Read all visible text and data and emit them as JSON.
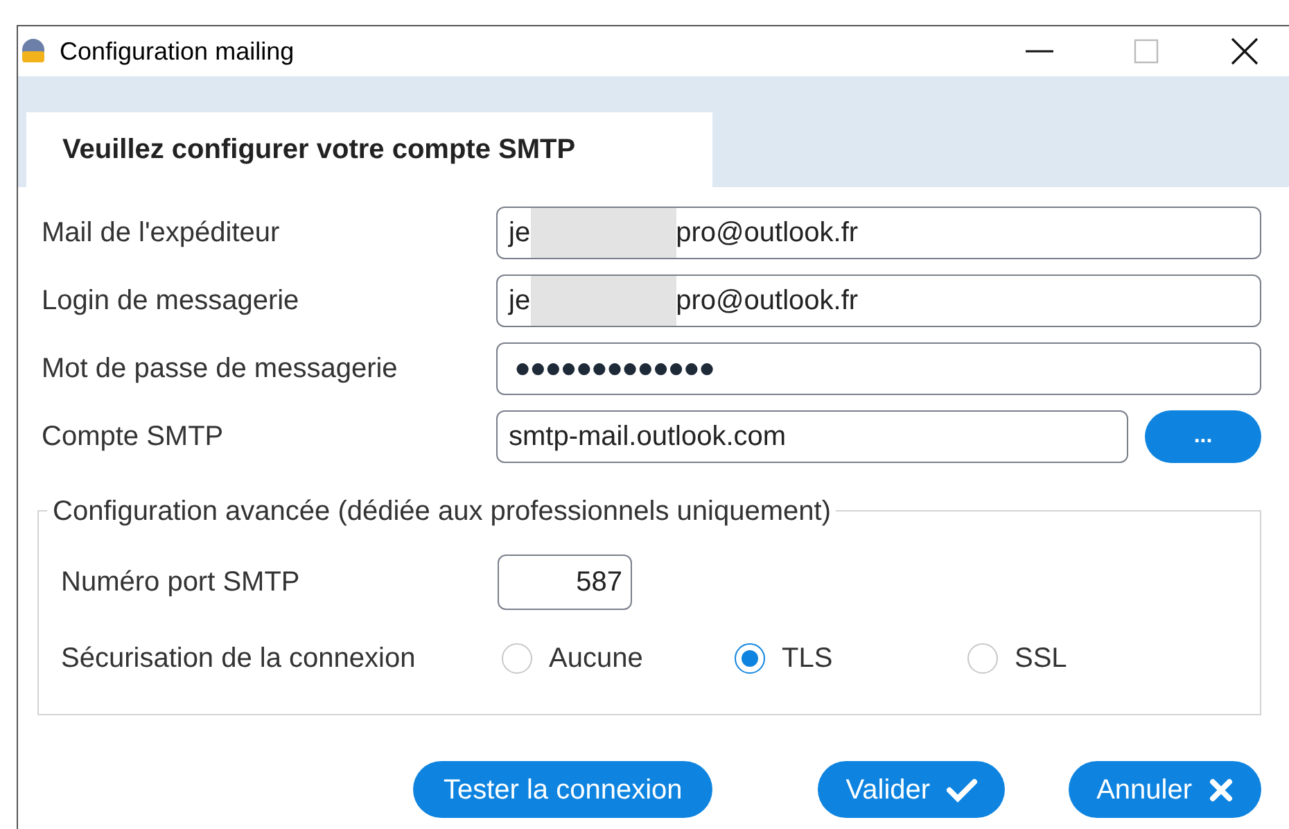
{
  "window": {
    "title": "Configuration mailing"
  },
  "tab": {
    "label": "Veuillez configurer votre compte SMTP",
    "selected": true
  },
  "fields": [
    {
      "kind": "redacted",
      "label": "Mail de l'expéditeur",
      "value_start": "je",
      "value_end": "pro@outlook.fr"
    },
    {
      "kind": "redacted",
      "label": "Login de messagerie",
      "value_start": "je",
      "value_end": "pro@outlook.fr"
    },
    {
      "kind": "password",
      "label": "Mot de passe de messagerie",
      "value": "●●●●●●●●●●●●●"
    },
    {
      "kind": "browse",
      "label": "Compte SMTP",
      "value": "smtp-mail.outlook.com",
      "button": "..."
    }
  ],
  "advanced": {
    "title": "Configuration avancée (dédiée aux professionnels uniquement)",
    "port_label": "Numéro port SMTP",
    "port": "587",
    "security_label": "Sécurisation de la connexion",
    "options": [
      {
        "label": "Aucune",
        "selected": false
      },
      {
        "label": "TLS",
        "selected": true
      },
      {
        "label": "SSL",
        "selected": false
      }
    ]
  },
  "buttons": [
    {
      "kind": "plain",
      "label": "Tester la connexion"
    },
    {
      "kind": "check",
      "label": "Valider"
    },
    {
      "kind": "cross",
      "label": "Annuler"
    }
  ]
}
